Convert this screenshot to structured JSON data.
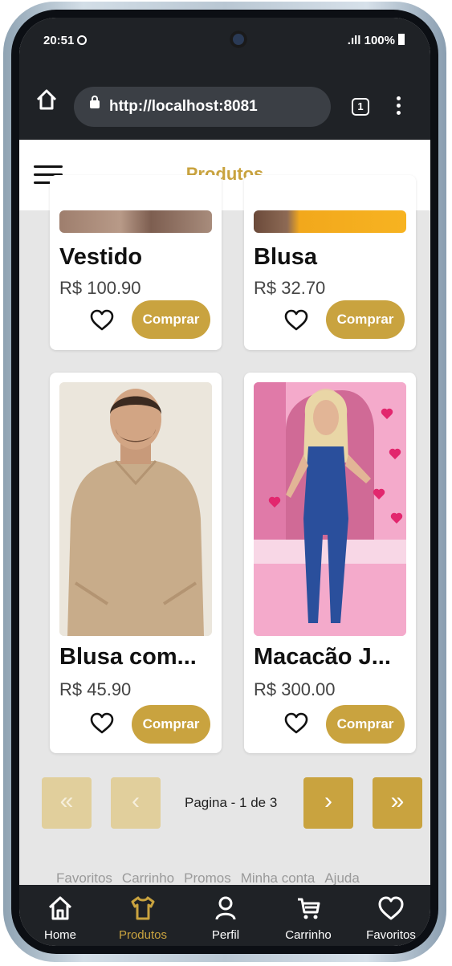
{
  "status_bar": {
    "time": "20:51",
    "signal": ".ıll",
    "battery": "100%"
  },
  "browser": {
    "url": "http://localhost:8081",
    "tab_count": "1"
  },
  "app": {
    "title": "Produtos"
  },
  "products": [
    {
      "name": "Vestido",
      "price": "R$ 100.90",
      "buy_label": "Comprar"
    },
    {
      "name": "Blusa",
      "price": "R$ 32.70",
      "buy_label": "Comprar"
    },
    {
      "name": "Blusa com...",
      "price": "R$ 45.90",
      "buy_label": "Comprar"
    },
    {
      "name": "Macacão J...",
      "price": "R$ 300.00",
      "buy_label": "Comprar"
    }
  ],
  "pagination": {
    "first": "«",
    "prev": "‹",
    "info": "Pagina - 1 de 3",
    "next": "›",
    "last": "»"
  },
  "footer_links": [
    "Favoritos",
    "Carrinho",
    "Promos",
    "Minha conta",
    "Ajuda"
  ],
  "bottom_nav": [
    {
      "label": "Home",
      "icon": "home-icon"
    },
    {
      "label": "Produtos",
      "icon": "shirt-icon",
      "active": true
    },
    {
      "label": "Perfil",
      "icon": "person-icon"
    },
    {
      "label": "Carrinho",
      "icon": "cart-icon"
    },
    {
      "label": "Favoritos",
      "icon": "heart-icon"
    }
  ],
  "colors": {
    "accent": "#c9a33f",
    "accent_disabled": "#e1cf9c",
    "bar": "#1f2226",
    "background": "#e6e6e6"
  }
}
